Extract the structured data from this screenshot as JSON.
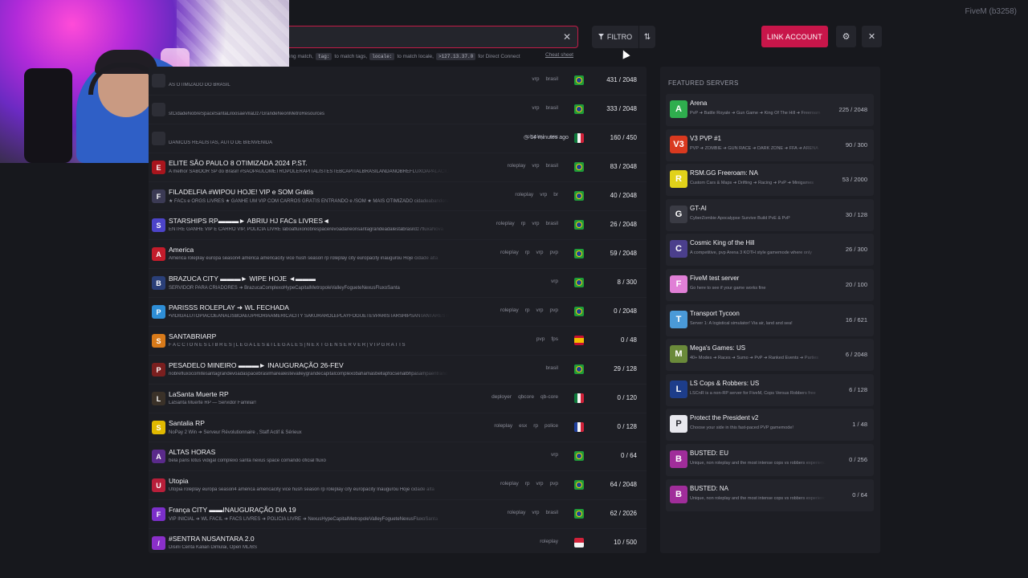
{
  "brand": "FiveM (b3258)",
  "search": {
    "hint_parts": [
      "ing match,",
      "tag:",
      "to match tags,",
      "locale:",
      "to match locale,",
      ">127.13.37.0",
      "for Direct Connect"
    ],
    "cheat_sheet": "Cheat sheet"
  },
  "toolbar": {
    "filter_label": "FILTRO",
    "sort_icon": "⇅",
    "link_account_label": "LINK ACCOUNT",
    "settings_icon": "⚙",
    "close_icon": "✕",
    "clear_icon": "✕"
  },
  "servers": [
    {
      "name": "",
      "desc": "AS OTIMIZADO DO BRASIL",
      "tags": [
        "vrp",
        "brasil"
      ],
      "time": "",
      "flag": "br",
      "players": "431 / 2048",
      "icon_color": "#2d2e36",
      "icon_text": ""
    },
    {
      "name": "",
      "desc": "stCidadeNobreSpaceSantaLiloosaeVilaDz7GrandeNeonMetroResources",
      "tags": [
        "vrp",
        "brasil"
      ],
      "time": "",
      "flag": "br",
      "players": "333 / 2048",
      "icon_color": "#2d2e36",
      "icon_text": ""
    },
    {
      "name": "",
      "desc": "DANICOS REALISTAS, AUTO DE BIENVENIDA",
      "tags": [
        "roleplay",
        "esx"
      ],
      "time": "14 minutes ago",
      "flag": "mx",
      "players": "160 / 450",
      "icon_color": "#2d2e36",
      "icon_text": ""
    },
    {
      "name": "ELITE SÃO PAULO 8 OTIMIZADA 2024 P.ST.",
      "desc": "A melhor SABOOR SP do Brasil! #SAOPAULOMETROPOLERAPITALISTESTEBCAPITALBRASILANDANOBREFLUXOAPALACIOMIL",
      "tags": [
        "roleplay",
        "vrp",
        "brasil"
      ],
      "time": "",
      "flag": "br",
      "players": "83 / 2048",
      "icon_color": "#a8151d",
      "icon_text": "E"
    },
    {
      "name": "FILADELFIA #WIPOU HOJE! VIP e SOM Grátis",
      "desc": "★ FACs e ORGS LIVRES ★ GANHE UM VIP COM CARROS GRÁTIS ENTRANDO e /SOM ★ MAIS OTIMIZADO cidadeabandonadooppe",
      "tags": [
        "roleplay",
        "vrp",
        "br"
      ],
      "time": "",
      "flag": "br",
      "players": "40 / 2048",
      "icon_color": "#3b3a54",
      "icon_text": "F"
    },
    {
      "name": "STARSHIPS RP▬▬▬► ABRIU HJ FACs LIVRES◄",
      "desc": "ENTRE GANHE VIP E CARRO VIP, POLICIA LIVRE laboafluxonobrespacerevoadaneonsantagrandeadalestabrasildz7fluxaNova",
      "tags": [
        "roleplay",
        "rp",
        "vrp",
        "brasil"
      ],
      "time": "",
      "flag": "br",
      "players": "26 / 2048",
      "icon_color": "#4c44c9",
      "icon_text": "S"
    },
    {
      "name": "America",
      "desc": "America roleplay europa season4 américa americacity vice hush season rp roleplay city europacity inaugurou Hoje cidade alta",
      "tags": [
        "roleplay",
        "rp",
        "vrp",
        "pvp"
      ],
      "time": "",
      "flag": "br",
      "players": "59 / 2048",
      "icon_color": "#c31c2b",
      "icon_text": "A"
    },
    {
      "name": "BRAZUCA CITY ▬▬▬► WIPE HOJE ◄▬▬▬",
      "desc": "SERVIDOR PARA CRIADORES ➜ BrazucaComplexoHypeCapitalMetropoleValleyFogueteNexusFluxoSanta",
      "tags": [
        "vrp"
      ],
      "time": "",
      "flag": "br",
      "players": "8 / 300",
      "icon_color": "#2a3f78",
      "icon_text": "B"
    },
    {
      "name": "PARISSS ROLEPLAY ➜ WL FECHADA",
      "desc": "•VIDIGALUTOPIACOEANALISBOAEUPHORIAAMERICACITY SAKURAROLEPLAYFOGUETEVPARISTARSHIPSANTANTARESTRYPOLI",
      "tags": [
        "roleplay",
        "rp",
        "vrp",
        "pvp"
      ],
      "time": "",
      "flag": "br",
      "players": "0 / 2048",
      "icon_color": "#2e8ed6",
      "icon_text": "P"
    },
    {
      "name": "SANTABRIARP",
      "desc": "F A C C I O N E S  L I B R E S | L E G A L E S  &  I L E G A L E S | N E X T  G E N  S E R V E R | V I P  G R A T I S",
      "tags": [
        "pvp",
        "fps"
      ],
      "time": "",
      "flag": "es",
      "players": "0 / 48",
      "icon_color": "#d87a1a",
      "icon_text": "S"
    },
    {
      "name": "PESADELO MINEIRO ▬▬▬► INAUGURAÇÃO 26-FEV",
      "desc": "nobrefluxocomitesantagrandevoadaspacebrasilmarealestevalleygrandecapitalcomplexobahamasbellapfocsenalbhpasampaentrano",
      "tags": [
        "brasil"
      ],
      "time": "",
      "flag": "br",
      "players": "29 / 128",
      "icon_color": "#7a1f1f",
      "icon_text": "P"
    },
    {
      "name": "LaSanta Muerte RP",
      "desc": "LaSanta Muerte RP — Servidor Familiar!",
      "tags": [
        "deployer",
        "qbcore",
        "qb-core"
      ],
      "time": "",
      "flag": "mx",
      "players": "0 / 120",
      "icon_color": "#3a3128",
      "icon_text": "L"
    },
    {
      "name": "Santalia RP",
      "desc": "NoPay 2 Win ➜ Serveur Révolutionnaire , Staff Actif & Sérieux",
      "tags": [
        "roleplay",
        "esx",
        "rp",
        "police"
      ],
      "time": "",
      "flag": "fr",
      "players": "0 / 128",
      "icon_color": "#e0b800",
      "icon_text": "S"
    },
    {
      "name": "ALTAS HORAS",
      "desc": "bela paris lotus vidigal complexo santa nexus space comando oficial fluxo",
      "tags": [
        "vrp"
      ],
      "time": "",
      "flag": "br",
      "players": "0 / 64",
      "icon_color": "#5a2a8a",
      "icon_text": "A"
    },
    {
      "name": "Utopia",
      "desc": "Utopia roleplay europa season4 américa americacity vice hush season rp roleplay city europacity Inaugurou Hoje cidade alta",
      "tags": [
        "roleplay",
        "rp",
        "vrp",
        "pvp"
      ],
      "time": "",
      "flag": "br",
      "players": "64 / 2048",
      "icon_color": "#b81f3a",
      "icon_text": "U"
    },
    {
      "name": "França CITY ▬▬INAUGURAÇÃO DIA 19",
      "desc": "VIP INICIAL ➜ WL FACIL ➜ FACS LIVRES ➜ POLICIA LIVRE ➜ NexusHypeCapitalMetropoleValleyFogueteNexusFluxoSanta",
      "tags": [
        "roleplay",
        "vrp",
        "brasil"
      ],
      "time": "",
      "flag": "br",
      "players": "62 / 2026",
      "icon_color": "#7b2fc9",
      "icon_text": "F"
    },
    {
      "name": "#SENTRA NUSANTARA 2.0",
      "desc": "Disini Cerita Kalian Dimulai, Open ML/BS",
      "tags": [
        "roleplay"
      ],
      "time": "",
      "flag": "id",
      "players": "10 / 500",
      "icon_color": "#8a2fc9",
      "icon_text": "/"
    }
  ],
  "featured": {
    "title": "FEATURED SERVERS",
    "items": [
      {
        "name": "Arena",
        "desc": "PvP ➜ Battle Royale ➜ Gun Game ➜ King Of The Hill ➜ Freeroam",
        "players": "225 / 2048",
        "icon_color": "#2fae4e",
        "icon_text": "A"
      },
      {
        "name": "V3 PVP #1",
        "desc": "PVP ➜ ZOMBIE ➜ GUN RACE ➜ DARK ZONE ➜ FFA ➜ ARENA",
        "players": "90 / 300",
        "icon_color": "#d9391f",
        "icon_text": "V3"
      },
      {
        "name": "RSM.GG Freeroam: NA",
        "desc": "Custom Cars & Maps ➜ Drifting ➜ Racing ➜ PvP ➜ Minigames",
        "players": "53 / 2000",
        "icon_color": "#e1d21a",
        "icon_text": "R"
      },
      {
        "name": "GT-AI",
        "desc": "CyberZombie Apocalypse Survive Build PvE & PvP",
        "players": "30 / 128",
        "icon_color": "#3a3b44",
        "icon_text": "G"
      },
      {
        "name": "Cosmic King of the Hill",
        "desc": "A competitive, pvp Arena 3 KOTH style gamemode where only",
        "players": "26 / 300",
        "icon_color": "#4b3f8c",
        "icon_text": "C"
      },
      {
        "name": "FiveM test server",
        "desc": "Go here to see if your game works fine",
        "players": "20 / 100",
        "icon_color": "#e07fd6",
        "icon_text": "F"
      },
      {
        "name": "Transport Tycoon",
        "desc": "Server 1: A logistical simulator! Via air, land and sea!",
        "players": "16 / 621",
        "icon_color": "#4a9ad8",
        "icon_text": "T"
      },
      {
        "name": "Mega's Games: US",
        "desc": "40+ Modes ➜ Races ➜ Sumo ➜ PvP ➜ Ranked Events ➜ Parties",
        "players": "6 / 2048",
        "icon_color": "#6a8a3a",
        "icon_text": "M"
      },
      {
        "name": "LS Cops & Robbers: US",
        "desc": "LSCnR is a non-RP server for FiveM, Cops Versus Robbers free",
        "players": "6 / 128",
        "icon_color": "#1d3d8a",
        "icon_text": "L"
      },
      {
        "name": "Protect the President v2",
        "desc": "Choose your side in this fast-paced PVP gamemode!",
        "players": "1 / 48",
        "icon_color": "#e8e8ee",
        "icon_text": "P"
      },
      {
        "name": "BUSTED: EU",
        "desc": "Unique, non roleplay and the most intense cops vs robbers experience",
        "players": "0 / 256",
        "icon_color": "#a02d9a",
        "icon_text": "B"
      },
      {
        "name": "BUSTED: NA",
        "desc": "Unique, non roleplay and the most intense cops vs robbers experience",
        "players": "0 / 64",
        "icon_color": "#a02d9a",
        "icon_text": "B"
      }
    ]
  }
}
